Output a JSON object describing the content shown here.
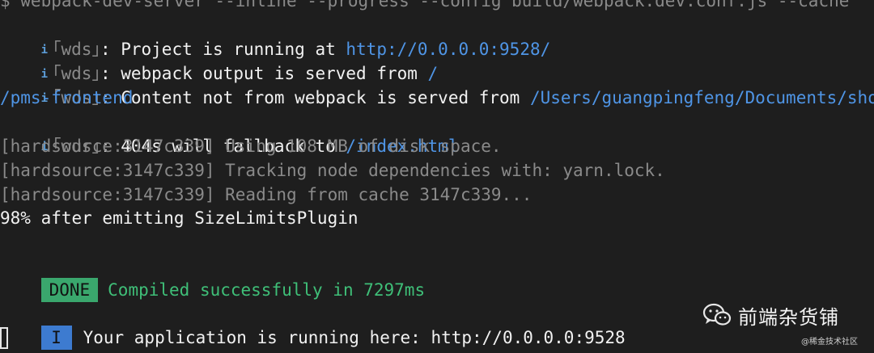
{
  "lines": {
    "cmd": "$ webpack-dev-server --inline --progress --config build/webpack.dev.conf.js --cache",
    "wds1": {
      "i": "i",
      "tag": "｢wds｣",
      "msg": ": Project is running at ",
      "path": "http://0.0.0.0:9528/"
    },
    "wds2": {
      "i": "i",
      "tag": "｢wds｣",
      "msg": ": webpack output is served from ",
      "path": "/"
    },
    "wds3": {
      "i": "i",
      "tag": "｢wds｣",
      "msg": ": Content not from webpack is served from ",
      "path": "/Users/guangpingfeng/Documents/sho"
    },
    "wds3_cont": "/pms-frontend",
    "wds4": {
      "i": "i",
      "tag": "｢wds｣",
      "msg": ": 404s will fallback to ",
      "path": "/index.html"
    },
    "hs1": "[hardsource:3147c339] Using 108 MB of disk space.",
    "hs2": "[hardsource:3147c339] Tracking node dependencies with: yarn.lock.",
    "hs3": "[hardsource:3147c339] Reading from cache 3147c339...",
    "progress": "98% after emitting SizeLimitsPlugin",
    "done_badge": "DONE",
    "done_msg": "Compiled successfully in 7297ms",
    "info_badge": "I",
    "info_msg": "Your application is running here: http://0.0.0.0:9528"
  },
  "brand": {
    "icon": "wechat-icon",
    "name": "前端杂货铺",
    "watermark": "@稀金技术社区"
  },
  "colors": {
    "background": "#1e1e1e",
    "path": "#4f95e6",
    "success": "#3fbf78",
    "done_badge": "#3aa76d",
    "info_badge": "#3d7bd0"
  }
}
